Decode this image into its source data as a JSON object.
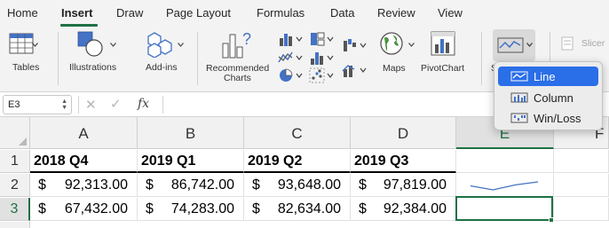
{
  "tabs": [
    {
      "label": "Home",
      "active": false
    },
    {
      "label": "Insert",
      "active": true
    },
    {
      "label": "Draw",
      "active": false
    },
    {
      "label": "Page Layout",
      "active": false
    },
    {
      "label": "Formulas",
      "active": false
    },
    {
      "label": "Data",
      "active": false
    },
    {
      "label": "Review",
      "active": false
    },
    {
      "label": "View",
      "active": false
    }
  ],
  "ribbon": {
    "tables": "Tables",
    "illustrations": "Illustrations",
    "addins": "Add-ins",
    "recommended_line1": "Recommended",
    "recommended_line2": "Charts",
    "maps": "Maps",
    "pivotchart": "PivotChart",
    "sparklines_partial": "S",
    "slicer": "Slicer"
  },
  "formula_bar": {
    "name_box": "E3",
    "cancel_symbol": "✕",
    "enter_symbol": "✓",
    "fx_label": "fx",
    "formula": ""
  },
  "sheet": {
    "columns": [
      "A",
      "B",
      "C",
      "D",
      "E",
      "F"
    ],
    "rows": [
      "1",
      "2",
      "3"
    ],
    "header_row": [
      "2018 Q4",
      "2019 Q1",
      "2019 Q2",
      "2019 Q3"
    ],
    "currency": "$",
    "data": [
      [
        "92,313.00",
        "86,742.00",
        "93,648.00",
        "97,819.00"
      ],
      [
        "67,432.00",
        "74,283.00",
        "82,634.00",
        "92,384.00"
      ]
    ],
    "selected_cell": "E3"
  },
  "sparkline_menu": {
    "items": [
      {
        "label": "Line",
        "icon": "line-sparkline-icon",
        "active": true
      },
      {
        "label": "Column",
        "icon": "column-sparkline-icon",
        "active": false
      },
      {
        "label": "Win/Loss",
        "icon": "winloss-sparkline-icon",
        "active": false
      }
    ]
  },
  "sparkline_row2_values": [
    92313,
    86742,
    93648,
    97819
  ],
  "colors": {
    "accent_green": "#1e7145",
    "menu_highlight": "#2a6ee8",
    "sparkline_blue": "#4472c4"
  }
}
